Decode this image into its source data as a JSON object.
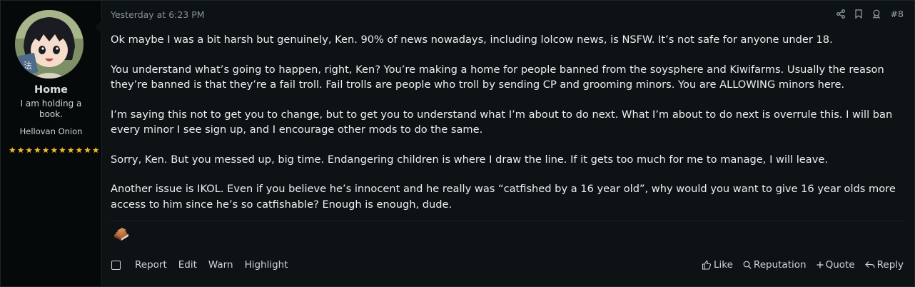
{
  "user": {
    "name": "Home",
    "title": "I am holding a book.",
    "rank": "Hellovan Onion",
    "stars": [
      "★",
      "★",
      "★",
      "★",
      "★",
      "★",
      "★",
      "★",
      "★",
      "★",
      "★"
    ]
  },
  "post": {
    "timestamp": "Yesterday at 6:23 PM",
    "number": "#8",
    "paragraphs": [
      "Ok maybe I was a bit harsh but genuinely, Ken. 90% of news nowadays, including lolcow news, is NSFW. It’s not safe for anyone under 18.",
      "You understand what’s going to happen, right, Ken? You’re making a home for people banned from the soysphere and Kiwifarms. Usually the reason they’re banned is that they’re a fail troll. Fail trolls are people who troll by sending CP and grooming minors. You are ALLOWING minors here.",
      "I’m saying this not to get you to change, but to get you to understand what I’m about to do next. What I’m about to do next is overrule this. I will ban every minor I see sign up, and I encourage other mods to do the same.",
      "Sorry, Ken. But you messed up, big time. Endangering children is where I draw the line. If it gets too much for me to manage, I will leave.",
      "Another issue is IKOL. Even if you believe he’s innocent and he really was “catfished by a 16 year old”, why would you want to give 16 year olds more access to him since he’s so catfishable? Enough is enough, dude."
    ]
  },
  "actions": {
    "report": "Report",
    "edit": "Edit",
    "warn": "Warn",
    "highlight": "Highlight",
    "like": "Like",
    "reputation": "Reputation",
    "quote": "Quote",
    "reply": "Reply"
  },
  "colors": {
    "background": "#0d1214",
    "sidebar": "#06090a",
    "star": "#f0c030"
  }
}
